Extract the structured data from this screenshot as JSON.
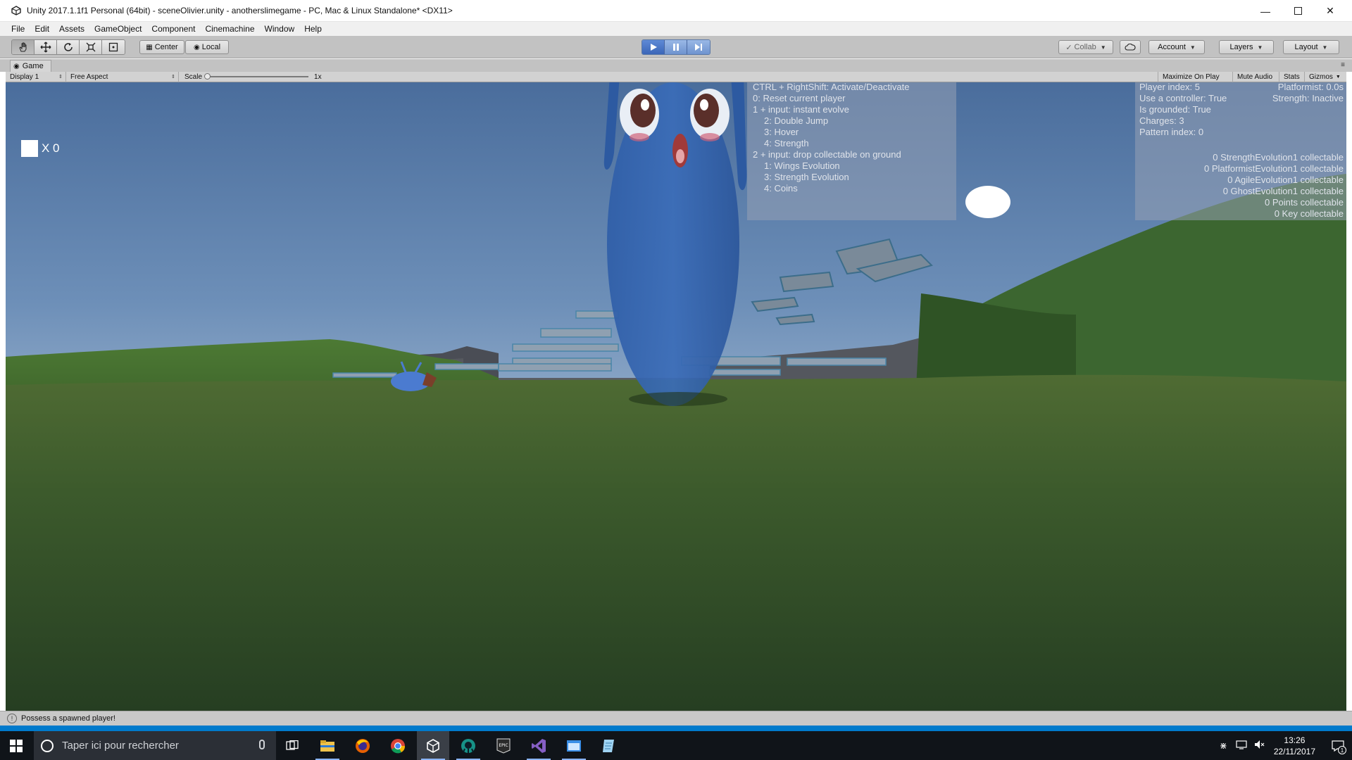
{
  "window": {
    "title": "Unity 2017.1.1f1 Personal (64bit) - sceneOlivier.unity - anotherslimegame - PC, Mac & Linux Standalone* <DX11>"
  },
  "menu": [
    "File",
    "Edit",
    "Assets",
    "GameObject",
    "Component",
    "Cinemachine",
    "Window",
    "Help"
  ],
  "toolbar": {
    "center_label": "Center",
    "local_label": "Local",
    "collab_label": "Collab",
    "account_label": "Account",
    "layers_label": "Layers",
    "layout_label": "Layout"
  },
  "game_view": {
    "tab_label": "Game",
    "display_label": "Display 1",
    "aspect_label": "Free Aspect",
    "scale_label": "Scale",
    "scale_value": "1x",
    "maximize_label": "Maximize On Play",
    "mute_label": "Mute Audio",
    "stats_label": "Stats",
    "gizmos_label": "Gizmos"
  },
  "hud": {
    "counter": "X 0"
  },
  "debug_left": [
    "CTRL + RightShift: Activate/Deactivate",
    "0: Reset current player",
    "1 + input: instant evolve",
    "  2: Double Jump",
    "  3: Hover",
    "  4: Strength",
    "2 + input: drop collectable on ground",
    "  1: Wings Evolution",
    "  3: Strength Evolution",
    "  4: Coins"
  ],
  "debug_right": {
    "left_lines": [
      "Player index: 5",
      "Use a controller: True",
      "Is grounded: True",
      "Charges: 3",
      "Pattern index: 0"
    ],
    "right_lines": [
      "Platformist: 0.0s",
      "Strength: Inactive"
    ],
    "collectables": [
      "0 StrengthEvolution1 collectable",
      "0 PlatformistEvolution1 collectable",
      "0 AgileEvolution1 collectable",
      "0 GhostEvolution1 collectable",
      "0 Points collectable",
      "0 Key collectable"
    ]
  },
  "status": {
    "message": "Possess a spawned player!"
  },
  "taskbar": {
    "search_placeholder": "Taper ici pour rechercher",
    "time": "13:26",
    "date": "22/11/2017",
    "notification_count": "1",
    "apps": [
      "task-view-icon",
      "file-explorer-icon",
      "firefox-icon",
      "chrome-icon",
      "unity-icon",
      "gitkraken-icon",
      "epic-games-icon",
      "visual-studio-icon",
      "app-window-icon",
      "notes-icon"
    ]
  },
  "colors": {
    "play_active": "#3b66b8",
    "status_strip": "#007acc",
    "taskbar_bg": "#101419"
  }
}
